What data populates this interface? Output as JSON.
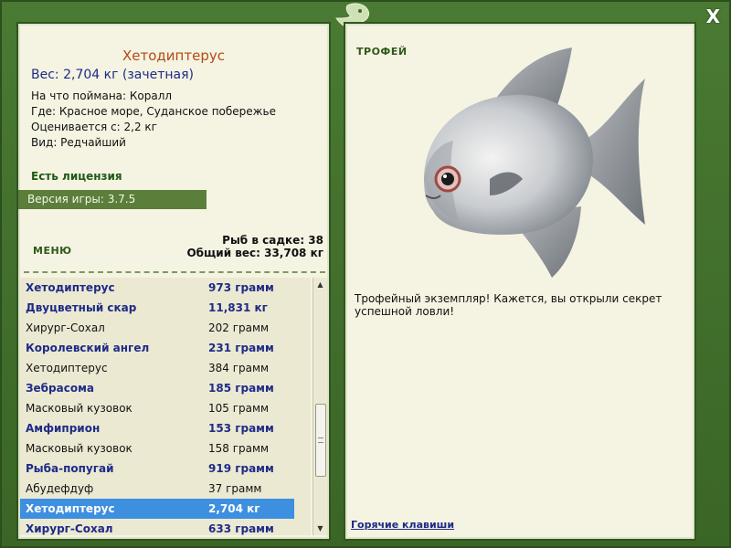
{
  "window": {
    "close_label": "X"
  },
  "catch": {
    "title": "Хетодиптерус",
    "weight_line": "Вес: 2,704 кг (зачетная)",
    "info": [
      "На что поймана: Коралл",
      "Где: Красное море, Суданское побережье",
      "Оценивается с: 2,2 кг",
      "Вид: Редчайший"
    ]
  },
  "license": "Есть лицензия",
  "version": "Версия игры: 3.7.5",
  "menu_label": "МЕНЮ",
  "stats": {
    "fish_in_cage": "Рыб в садке: 38",
    "total_weight": "Общий вес: 33,708 кг"
  },
  "fish_list": [
    {
      "name": "Хетодиптерус",
      "weight": "973 грамм",
      "style": "bold"
    },
    {
      "name": "Двуцветный скар",
      "weight": "11,831 кг",
      "style": "bold"
    },
    {
      "name": "Хирург-Сохал",
      "weight": "202 грамм",
      "style": "normal"
    },
    {
      "name": "Королевский ангел",
      "weight": "231 грамм",
      "style": "bold"
    },
    {
      "name": "Хетодиптерус",
      "weight": "384 грамм",
      "style": "normal"
    },
    {
      "name": "Зебрасома",
      "weight": "185 грамм",
      "style": "bold"
    },
    {
      "name": "Масковый кузовок",
      "weight": "105 грамм",
      "style": "normal"
    },
    {
      "name": "Амфиприон",
      "weight": "153 грамм",
      "style": "bold"
    },
    {
      "name": "Масковый кузовок",
      "weight": "158 грамм",
      "style": "normal"
    },
    {
      "name": "Рыба-попугай",
      "weight": "919 грамм",
      "style": "bold"
    },
    {
      "name": "Абудефдуф",
      "weight": "37 грамм",
      "style": "normal"
    },
    {
      "name": "Хетодиптерус",
      "weight": "2,704 кг",
      "style": "selected"
    },
    {
      "name": "Хирург-Сохал",
      "weight": "633 грамм",
      "style": "bold"
    }
  ],
  "trophy": {
    "label": "ТРОФЕЙ",
    "description": "Трофейный экземпляр! Кажется, вы открыли секрет успешной ловли!"
  },
  "hotkeys": "Горячие клавиши",
  "colors": {
    "frame": "#3f6a29",
    "panel_bg": "#f5f3e2",
    "title": "#b34a14",
    "link_blue": "#1e2b88",
    "selected_row": "#3d8fe0",
    "version_bar": "#5b7f3a"
  },
  "icons": {
    "scroll_up": "triangle-up",
    "scroll_down": "triangle-down"
  }
}
